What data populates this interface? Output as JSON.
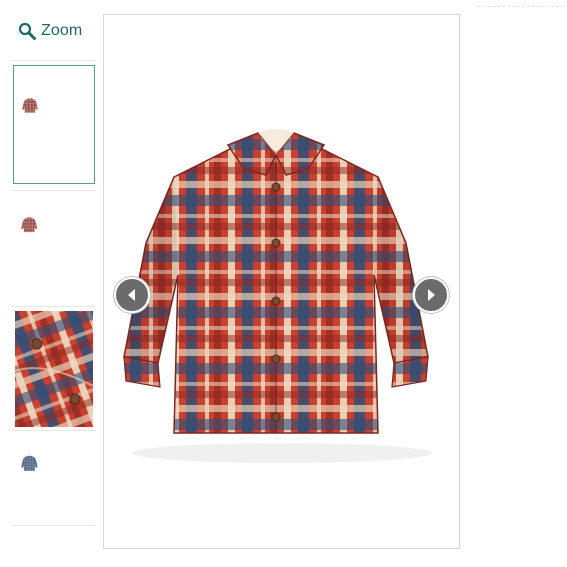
{
  "zoom": {
    "label": "Zoom",
    "icon": "magnifier-icon"
  },
  "colors": {
    "accent": "#1d6b68",
    "selected_border": "#5a9b8c",
    "arrow_bg": "#6b6b6b",
    "plaid_red": "#c8402e",
    "plaid_navy": "#2f4f78",
    "plaid_cream": "#efdcc2"
  },
  "gallery": {
    "thumbnails": [
      {
        "name": "front-view",
        "selected": true
      },
      {
        "name": "back-view",
        "selected": false
      },
      {
        "name": "fabric-detail",
        "selected": false
      },
      {
        "name": "blue-check-variant",
        "selected": false
      }
    ],
    "prev_icon": "chevron-left-icon",
    "next_icon": "chevron-right-icon"
  }
}
